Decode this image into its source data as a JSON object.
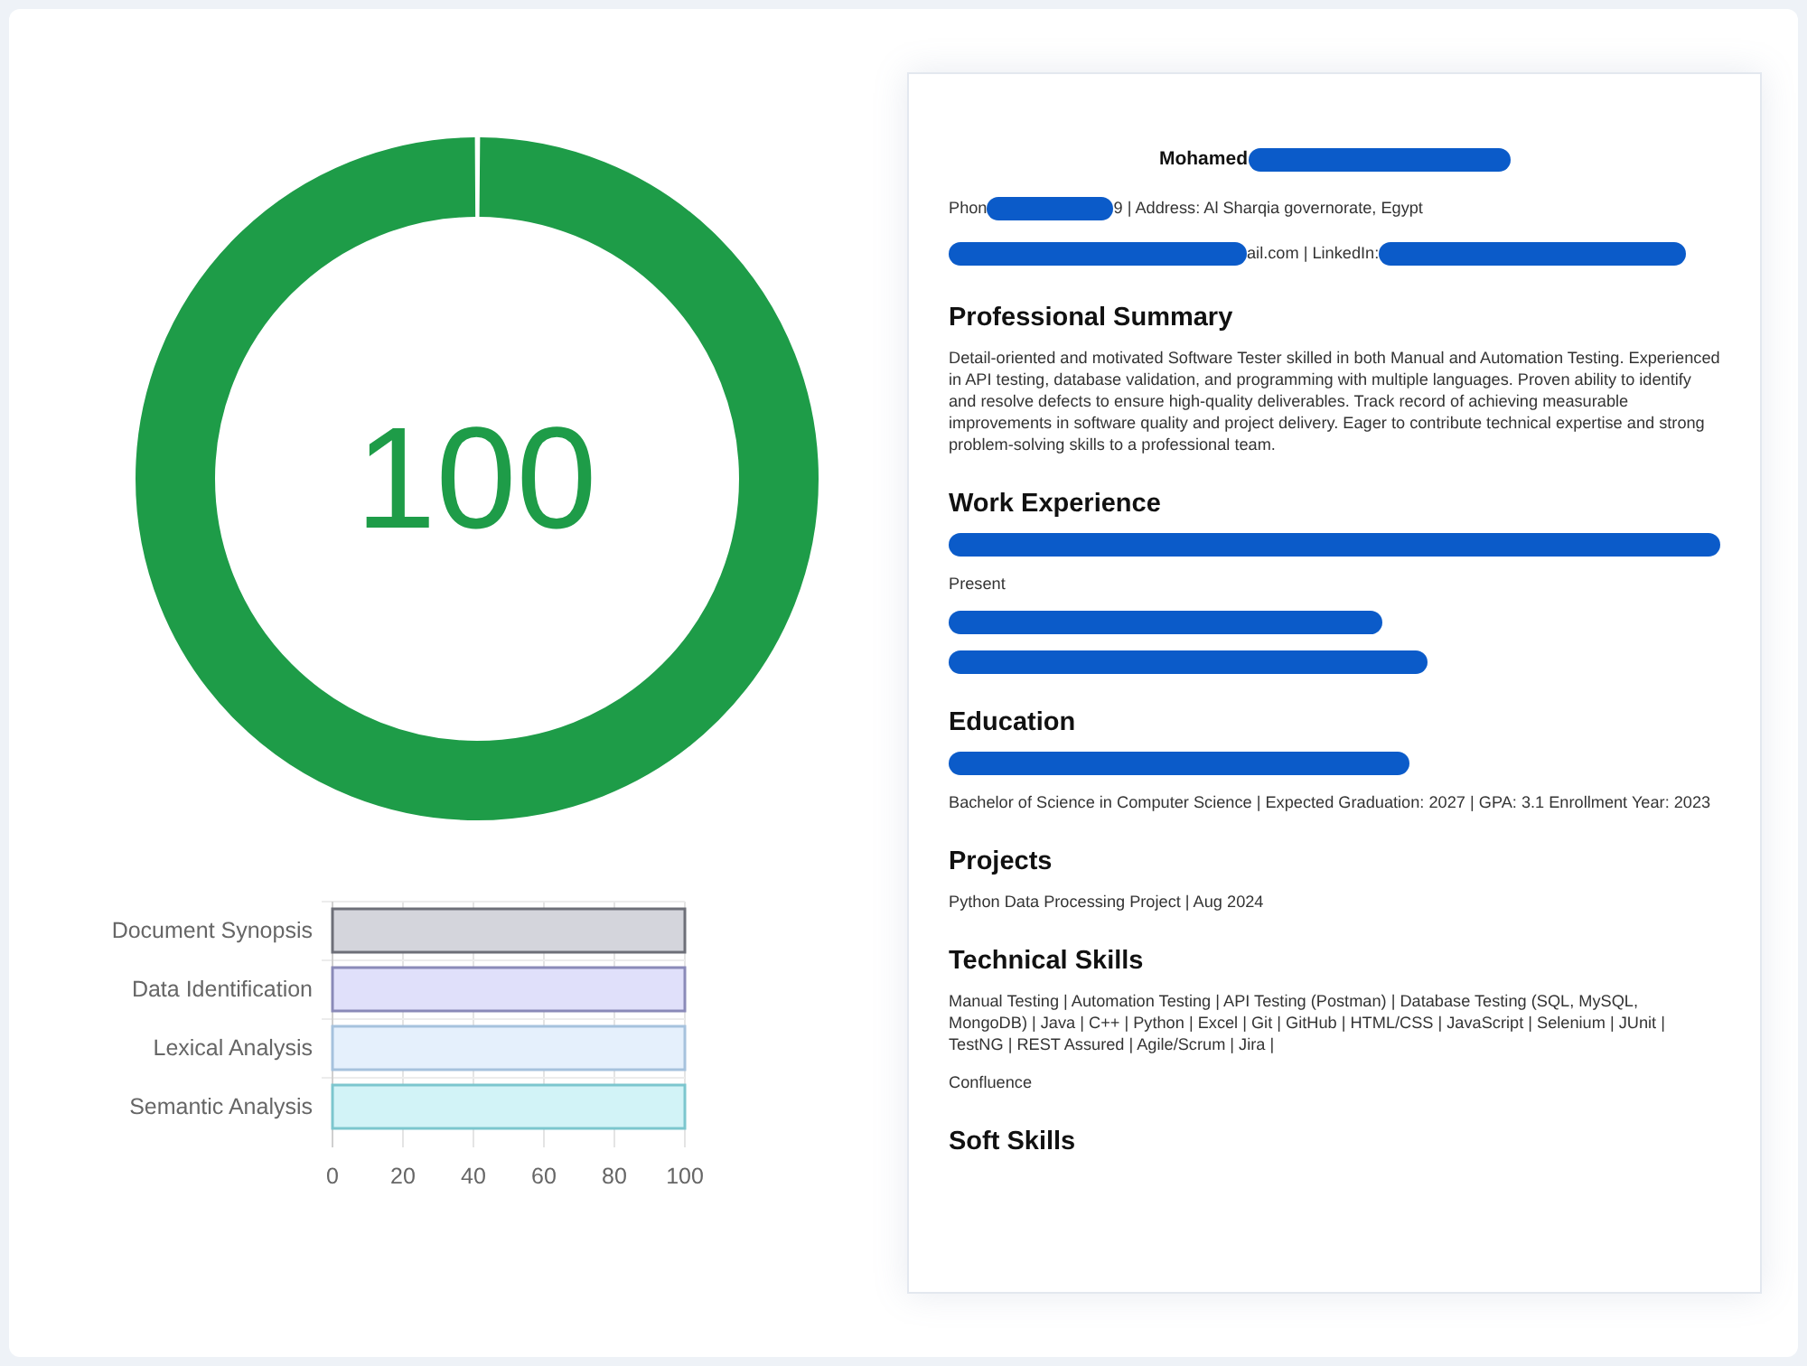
{
  "score": {
    "value": "100",
    "level": 1
  },
  "breakdown": {
    "chart_data": {
      "type": "bar",
      "orientation": "horizontal",
      "categories": [
        "Document Synopsis",
        "Data Identification",
        "Lexical Analysis",
        "Semantic Analysis"
      ],
      "values": [
        100,
        100,
        100,
        100
      ],
      "xlim": [
        0,
        100
      ],
      "xticks": [
        0,
        20,
        40,
        60,
        80,
        100
      ],
      "grid": true
    }
  },
  "resume": {
    "header": [
      {
        "kind": "name",
        "parts": [
          {
            "kind": "text",
            "text": "Mohamed"
          },
          {
            "kind": "redacted"
          }
        ]
      },
      {
        "kind": "contact",
        "parts": [
          {
            "kind": "text",
            "text": "Phon"
          },
          {
            "kind": "redacted"
          },
          {
            "kind": "text",
            "text": "9 | Address: Al Sharqia governorate, Egypt"
          }
        ]
      },
      {
        "kind": "contact",
        "parts": [
          {
            "kind": "redacted"
          },
          {
            "kind": "text",
            "text": "ail.com | LinkedIn:"
          },
          {
            "kind": "redacted"
          }
        ]
      }
    ],
    "sections": [
      {
        "heading": "Professional Summary",
        "lines": [
          [
            {
              "kind": "text",
              "text": "Detail-oriented and motivated Software Tester skilled in both Manual and Automation Testing. Experienced in API testing, database validation, and programming with multiple languages. Proven ability to identify and resolve defects to ensure high-quality deliverables. Track record of achieving measurable improvements in software quality and project delivery. Eager to contribute technical expertise and strong problem-solving skills to a professional team."
            }
          ]
        ]
      },
      {
        "heading": "Work Experience",
        "lines": [
          [
            {
              "kind": "redacted"
            }
          ],
          [
            {
              "kind": "text",
              "text": "Present"
            }
          ],
          [
            {
              "kind": "redacted"
            }
          ],
          [
            {
              "kind": "redacted"
            }
          ]
        ]
      },
      {
        "heading": "Education",
        "lines": [
          [
            {
              "kind": "redacted"
            }
          ],
          [
            {
              "kind": "text",
              "text": "Bachelor of Science in Computer Science | Expected Graduation: 2027 | GPA: 3.1 Enrollment Year: 2023"
            }
          ]
        ]
      },
      {
        "heading": "Projects",
        "lines": [
          [
            {
              "kind": "text",
              "text": "Python Data Processing Project | Aug 2024"
            }
          ]
        ]
      },
      {
        "heading": "Technical Skills",
        "lines": [
          [
            {
              "kind": "text",
              "text": "Manual Testing | Automation Testing | API Testing (Postman) | Database Testing (SQL, MySQL, MongoDB) | Java | C++ | Python | Excel | Git | GitHub | HTML/CSS | JavaScript | Selenium | JUnit | TestNG | REST Assured | Agile/Scrum | Jira |"
            }
          ],
          [
            {
              "kind": "text",
              "text": "Confluence"
            }
          ]
        ]
      },
      {
        "heading": "Soft Skills"
      }
    ]
  }
}
